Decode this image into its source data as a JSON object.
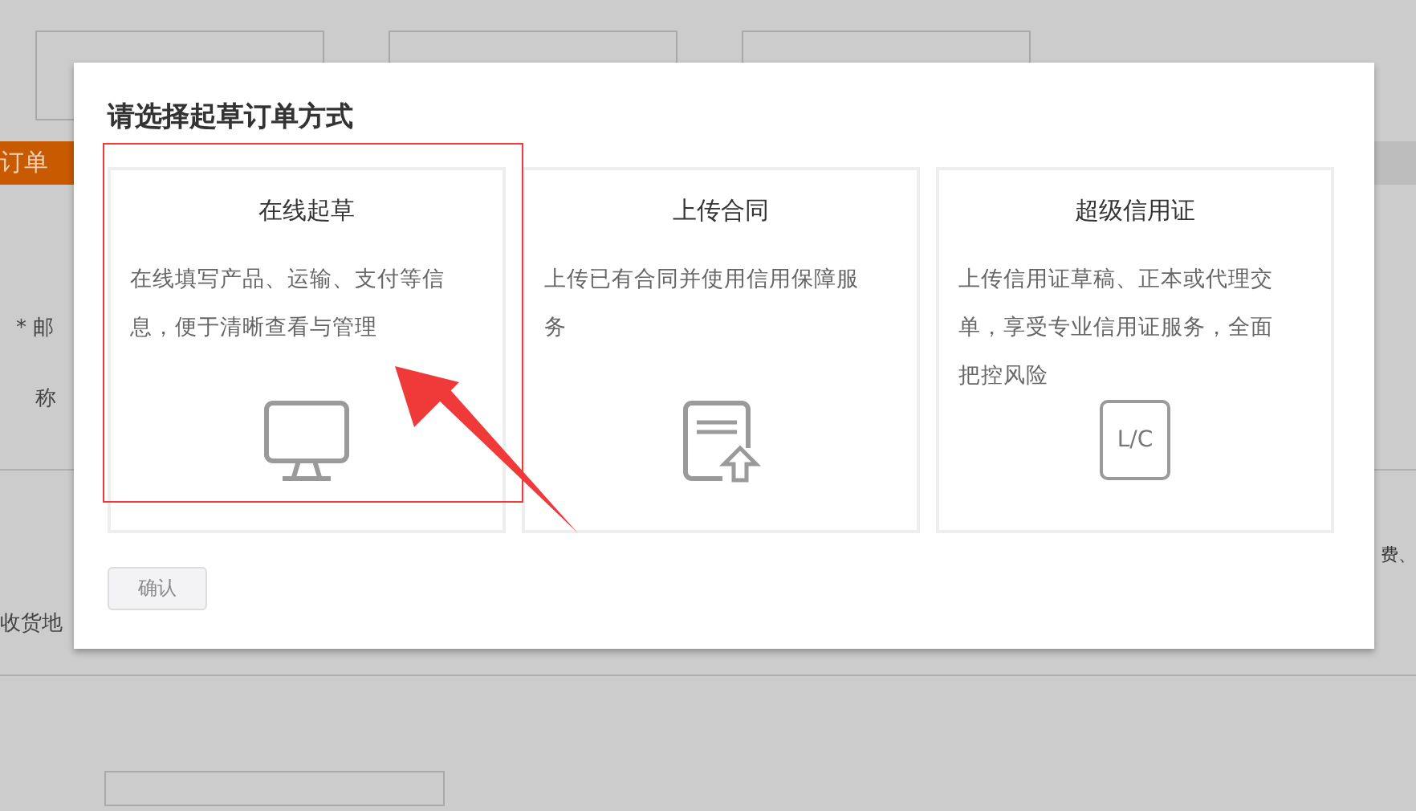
{
  "background_page": {
    "tab": "订单",
    "labels": [
      {
        "text": "* 邮",
        "required": true
      },
      {
        "text": "称",
        "required": false
      }
    ],
    "note_fragment": "费、",
    "address_label": "收货地"
  },
  "dialog": {
    "title": "请选择起草订单方式",
    "options": [
      {
        "title": "在线起草",
        "description": "在线填写产品、运输、支付等信息，便于清晰查看与管理",
        "kind": "monitor"
      },
      {
        "title": "上传合同",
        "description": "上传已有合同并使用信用保障服务",
        "kind": "upload"
      },
      {
        "title": "超级信用证",
        "description": "上传信用证草稿、正本或代理交单，享受专业信用证服务，全面把控风险",
        "kind": "lc",
        "icon_text": "L/C"
      }
    ],
    "confirm": {
      "label": "确认",
      "disabled": true
    }
  }
}
